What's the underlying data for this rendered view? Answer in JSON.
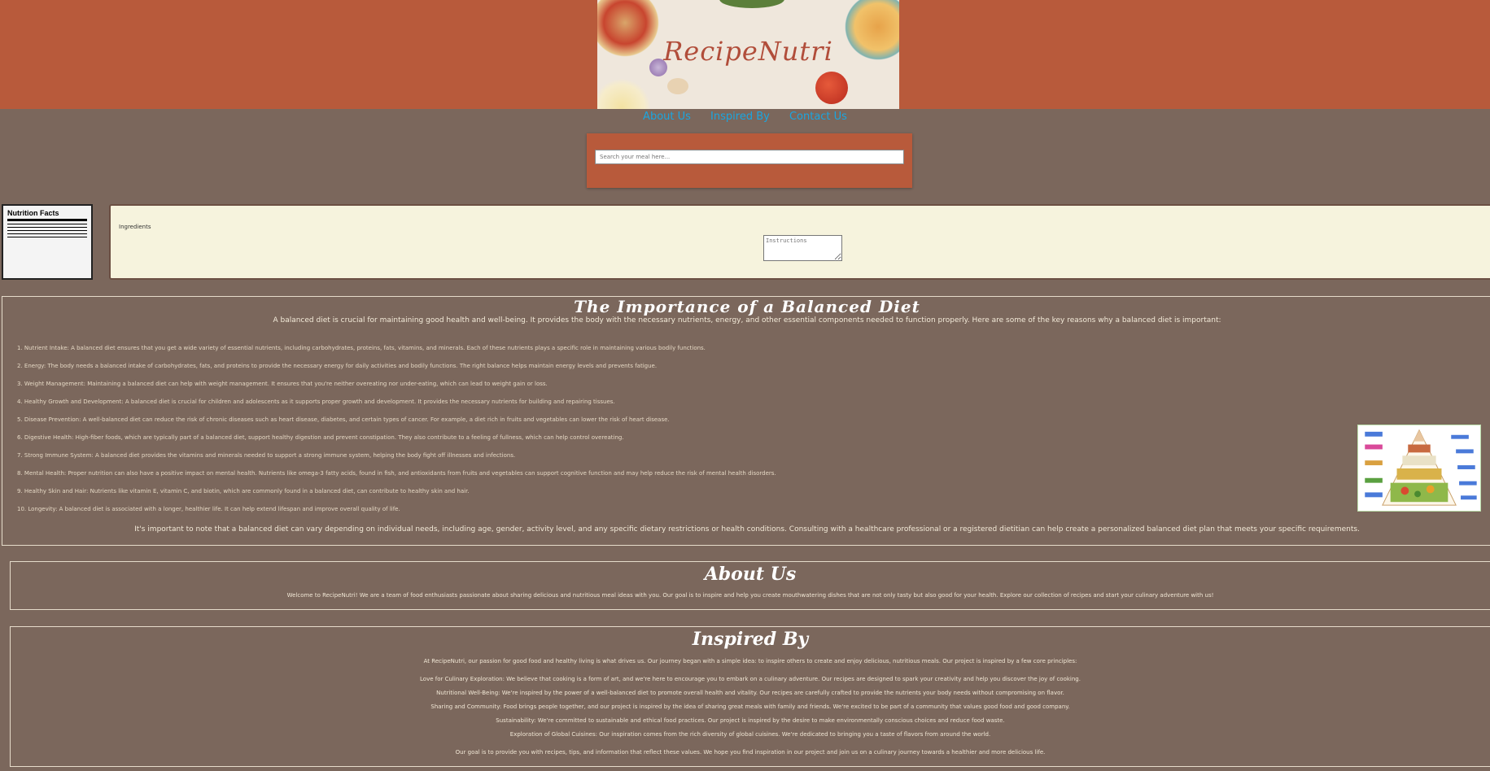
{
  "banner": {
    "title": "RecipeNutri"
  },
  "nav": {
    "items": [
      "About Us",
      "Inspired By",
      "Contact Us"
    ]
  },
  "search": {
    "placeholder": "Search your meal here..."
  },
  "nutrition": {
    "title": "Nutrition Facts"
  },
  "recipe": {
    "ingredients_label": "Ingredients",
    "instructions_placeholder": "Instructions"
  },
  "balanced": {
    "title": "The Importance of a Balanced Diet",
    "intro": "A balanced diet is crucial for maintaining good health and well-being. It provides the body with the necessary nutrients, energy, and other essential components needed to function properly. Here are some of the key reasons why a balanced diet is important:",
    "items": [
      "1. Nutrient Intake: A balanced diet ensures that you get a wide variety of essential nutrients, including carbohydrates, proteins, fats, vitamins, and minerals. Each of these nutrients plays a specific role in maintaining various bodily functions.",
      "2. Energy: The body needs a balanced intake of carbohydrates, fats, and proteins to provide the necessary energy for daily activities and bodily functions. The right balance helps maintain energy levels and prevents fatigue.",
      "3. Weight Management: Maintaining a balanced diet can help with weight management. It ensures that you're neither overeating nor under-eating, which can lead to weight gain or loss.",
      "4. Healthy Growth and Development: A balanced diet is crucial for children and adolescents as it supports proper growth and development. It provides the necessary nutrients for building and repairing tissues.",
      "5. Disease Prevention: A well-balanced diet can reduce the risk of chronic diseases such as heart disease, diabetes, and certain types of cancer. For example, a diet rich in fruits and vegetables can lower the risk of heart disease.",
      "6. Digestive Health: High-fiber foods, which are typically part of a balanced diet, support healthy digestion and prevent constipation. They also contribute to a feeling of fullness, which can help control overeating.",
      "7. Strong Immune System: A balanced diet provides the vitamins and minerals needed to support a strong immune system, helping the body fight off illnesses and infections.",
      "8. Mental Health: Proper nutrition can also have a positive impact on mental health. Nutrients like omega-3 fatty acids, found in fish, and antioxidants from fruits and vegetables can support cognitive function and may help reduce the risk of mental health disorders.",
      "9. Healthy Skin and Hair: Nutrients like vitamin E, vitamin C, and biotin, which are commonly found in a balanced diet, can contribute to healthy skin and hair.",
      "10. Longevity: A balanced diet is associated with a longer, healthier life. It can help extend lifespan and improve overall quality of life."
    ],
    "note": "It's important to note that a balanced diet can vary depending on individual needs, including age, gender, activity level, and any specific dietary restrictions or health conditions. Consulting with a healthcare professional or a registered dietitian can help create a personalized balanced diet plan that meets your specific requirements."
  },
  "about": {
    "title": "About Us",
    "text": "Welcome to RecipeNutri! We are a team of food enthusiasts passionate about sharing delicious and nutritious meal ideas with you. Our goal is to inspire and help you create mouthwatering dishes that are not only tasty but also good for your health. Explore our collection of recipes and start your culinary adventure with us!"
  },
  "inspired": {
    "title": "Inspired By",
    "intro": "At RecipeNutri, our passion for good food and healthy living is what drives us. Our journey began with a simple idea: to inspire others to create and enjoy delicious, nutritious meals. Our project is inspired by a few core principles:",
    "points": [
      "Love for Culinary Exploration: We believe that cooking is a form of art, and we're here to encourage you to embark on a culinary adventure. Our recipes are designed to spark your creativity and help you discover the joy of cooking.",
      "Nutritional Well-Being: We're inspired by the power of a well-balanced diet to promote overall health and vitality. Our recipes are carefully crafted to provide the nutrients your body needs without compromising on flavor.",
      "Sharing and Community: Food brings people together, and our project is inspired by the idea of sharing great meals with family and friends. We're excited to be part of a community that values good food and good company.",
      "Sustainability: We're committed to sustainable and ethical food practices. Our project is inspired by the desire to make environmentally conscious choices and reduce food waste.",
      "Exploration of Global Cuisines: Our inspiration comes from the rich diversity of global cuisines. We're dedicated to bringing you a taste of flavors from around the world."
    ],
    "outro": "Our goal is to provide you with recipes, tips, and information that reflect these values. We hope you find inspiration in our project and join us on a culinary journey towards a healthier and more delicious life."
  },
  "colors": {
    "header": "#b85a3b",
    "background": "#7b675c",
    "link": "#1aa6e0",
    "recipe_card": "#f6f3dd"
  }
}
